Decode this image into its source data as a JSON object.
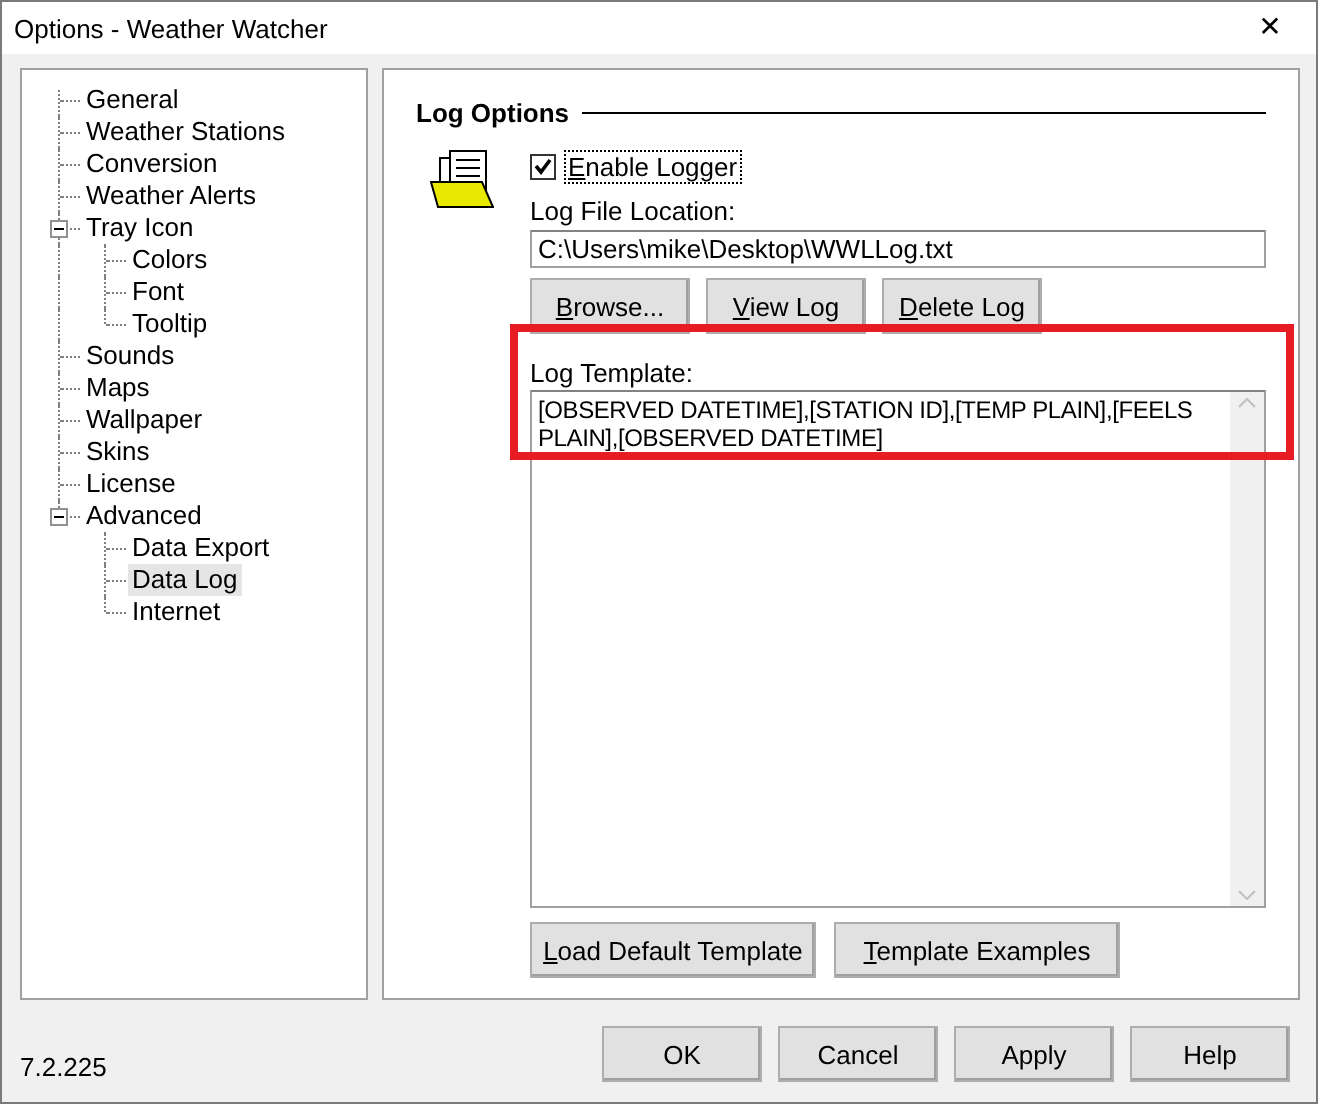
{
  "window": {
    "title": "Options - Weather Watcher",
    "close": "✕"
  },
  "tree": [
    {
      "label": "General",
      "selected": false
    },
    {
      "label": "Weather Stations",
      "selected": false
    },
    {
      "label": "Conversion",
      "selected": false
    },
    {
      "label": "Weather Alerts",
      "selected": false
    },
    {
      "label": "Tray Icon",
      "selected": false,
      "expanded": true,
      "children": [
        {
          "label": "Colors",
          "selected": false
        },
        {
          "label": "Font",
          "selected": false
        },
        {
          "label": "Tooltip",
          "selected": false
        }
      ]
    },
    {
      "label": "Sounds",
      "selected": false
    },
    {
      "label": "Maps",
      "selected": false
    },
    {
      "label": "Wallpaper",
      "selected": false
    },
    {
      "label": "Skins",
      "selected": false
    },
    {
      "label": "License",
      "selected": false
    },
    {
      "label": "Advanced",
      "selected": false,
      "expanded": true,
      "children": [
        {
          "label": "Data Export",
          "selected": false
        },
        {
          "label": "Data Log",
          "selected": true
        },
        {
          "label": "Internet",
          "selected": false
        }
      ]
    }
  ],
  "panel": {
    "title": "Log Options",
    "enable_logger": {
      "label": "Enable Logger",
      "checked": true,
      "focused": true,
      "underline_first": true
    },
    "file_location": {
      "label": "Log File Location:",
      "value": "C:\\Users\\mike\\Desktop\\WWLLog.txt"
    },
    "file_buttons": [
      {
        "label": "Browse...",
        "underline_first": true
      },
      {
        "label": "View Log",
        "underline_first": true
      },
      {
        "label": "Delete Log",
        "underline_first": true
      }
    ],
    "template": {
      "label": "Log Template:",
      "value": "[OBSERVED DATETIME],[STATION ID],[TEMP PLAIN],[FEELS PLAIN],[OBSERVED DATETIME]",
      "highlighted": true
    },
    "template_buttons": [
      {
        "label": "Load Default Template",
        "underline_first": true
      },
      {
        "label": "Template Examples",
        "underline_first": true
      }
    ]
  },
  "version": "7.2.225",
  "buttons": [
    {
      "label": "OK"
    },
    {
      "label": "Cancel"
    },
    {
      "label": "Apply"
    },
    {
      "label": "Help"
    }
  ]
}
